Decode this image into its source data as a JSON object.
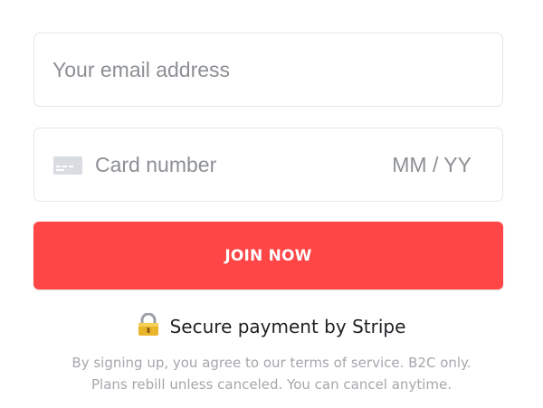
{
  "email_field": {
    "placeholder": "Your email address"
  },
  "card_field": {
    "icon": "credit-card-icon",
    "card_number_placeholder": "Card number",
    "expiry_placeholder": "MM / YY"
  },
  "join_button": {
    "label": "JOIN NOW",
    "color": "#ff4646"
  },
  "secure_payment": {
    "icon": "lock-icon",
    "text": "Secure payment by Stripe"
  },
  "terms": {
    "line1": "By signing up, you agree to our terms of service. B2C only.",
    "line2": "Plans rebill unless canceled. You can cancel anytime."
  }
}
